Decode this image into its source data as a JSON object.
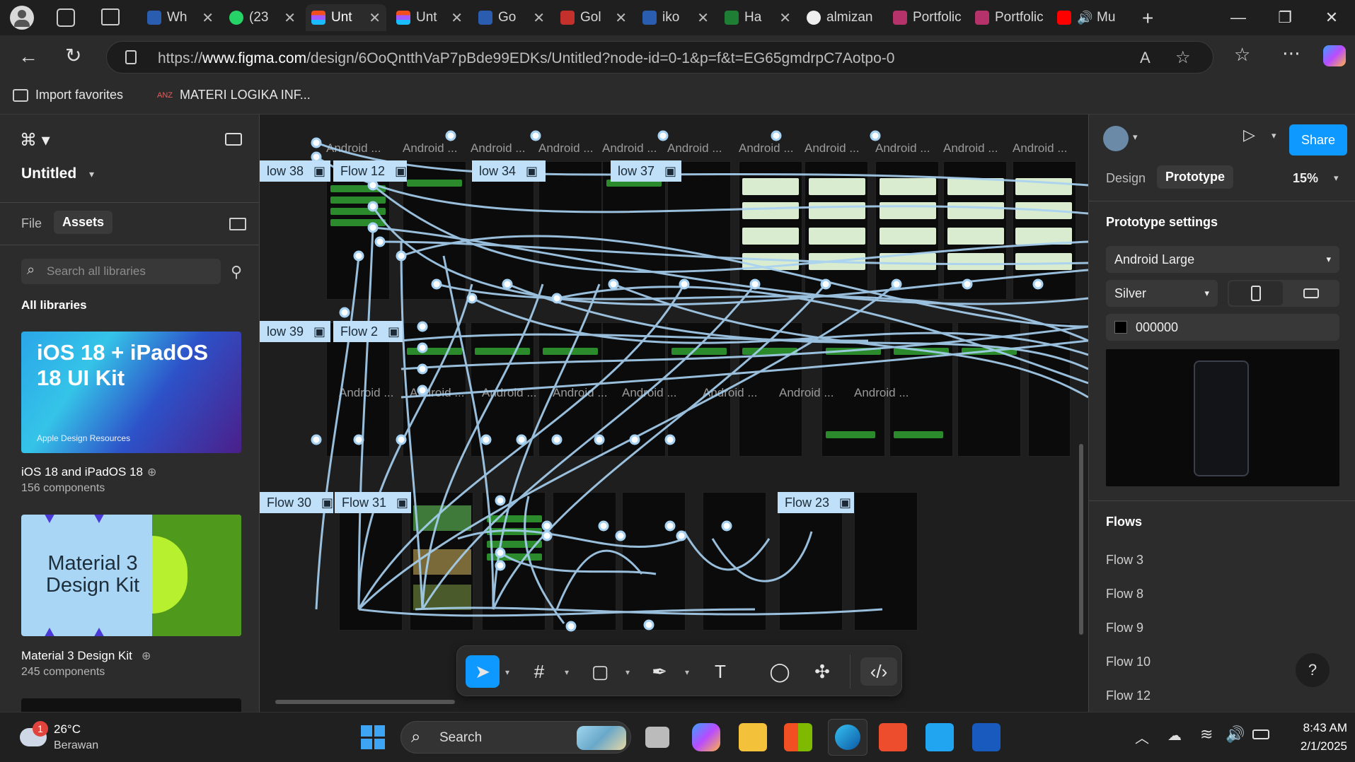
{
  "browser": {
    "tabs": [
      {
        "label": "Wh",
        "icon": "search-icon"
      },
      {
        "label": "(23",
        "icon": "whatsapp-icon"
      },
      {
        "label": "Unt",
        "icon": "figma-icon",
        "active": true
      },
      {
        "label": "Unt",
        "icon": "figma-icon"
      },
      {
        "label": "Go",
        "icon": "search-icon"
      },
      {
        "label": "Gol",
        "icon": "youtube-icon"
      },
      {
        "label": "iko",
        "icon": "search-icon"
      },
      {
        "label": "Ha",
        "icon": "sheet-icon"
      },
      {
        "label": "almizan",
        "icon": "github-icon"
      },
      {
        "label": "Portfolic",
        "icon": "h-icon"
      },
      {
        "label": "Portfolic",
        "icon": "h-icon"
      },
      {
        "label": "Mu",
        "icon": "youtube-icon"
      }
    ],
    "url_prefix": "https://",
    "url_host": "www.figma.com",
    "url_path": "/design/6OoQntthVaP7pBde99EDKs/Untitled?node-id=0-1&p=f&t=EG65gmdrpC7Aotpo-0",
    "favorites": [
      "Import favorites",
      "MATERI LOGIKA INF..."
    ]
  },
  "figma": {
    "file_name": "Untitled",
    "left_tabs": {
      "file": "File",
      "assets": "Assets"
    },
    "search_placeholder": "Search all libraries",
    "all_libraries": "All libraries",
    "libraries": [
      {
        "title": "iOS 18 and iPadOS 18",
        "count": "156 components",
        "banner": "iOS 18 + iPadOS 18 UI Kit",
        "sub": "Apple Design Resources"
      },
      {
        "title": "Material 3 Design Kit",
        "count": "245 components",
        "banner": "Material 3 Design Kit"
      }
    ],
    "right": {
      "share": "Share",
      "tab_design": "Design",
      "tab_prototype": "Prototype",
      "zoom": "15%",
      "section_title": "Prototype settings",
      "device": "Android Large",
      "model": "Silver",
      "color": "000000",
      "flows_title": "Flows",
      "flows": [
        "Flow 3",
        "Flow 8",
        "Flow 9",
        "Flow 10",
        "Flow 12"
      ],
      "help": "?"
    },
    "canvas": {
      "frame_label": "Android ...",
      "flow_chips": [
        "low 38",
        "Flow 12",
        "low 34",
        "low 37",
        "low 39",
        "Flow 2",
        "Flow 30",
        "Flow 31",
        "Flow 23"
      ]
    }
  },
  "taskbar": {
    "temp": "26°C",
    "weather": "Berawan",
    "badge": "1",
    "search": "Search",
    "time": "8:43 AM",
    "date": "2/1/2025"
  }
}
